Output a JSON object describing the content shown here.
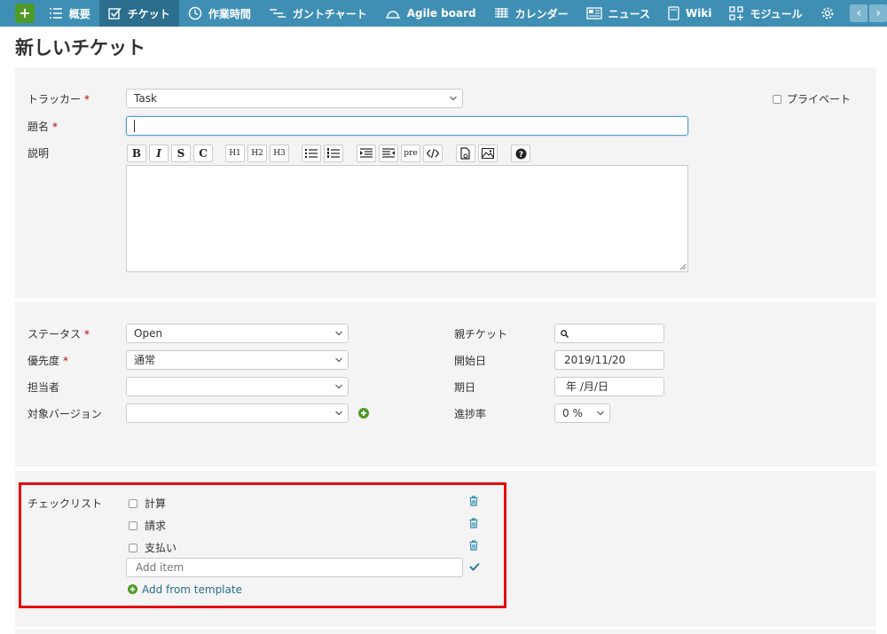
{
  "nav": {
    "items": [
      {
        "label": "概要",
        "icon": "list-icon"
      },
      {
        "label": "チケット",
        "icon": "checkbox-icon",
        "active": true
      },
      {
        "label": "作業時間",
        "icon": "clock-icon"
      },
      {
        "label": "ガントチャート",
        "icon": "gantt-icon"
      },
      {
        "label": "Agile board",
        "icon": "agile-icon"
      },
      {
        "label": "カレンダー",
        "icon": "calendar-icon"
      },
      {
        "label": "ニュース",
        "icon": "news-icon"
      },
      {
        "label": "Wiki",
        "icon": "wiki-icon"
      },
      {
        "label": "モジュール",
        "icon": "modules-icon"
      }
    ],
    "accent": "#3f8fb5"
  },
  "page": {
    "title": "新しいチケット"
  },
  "form": {
    "tracker": {
      "label": "トラッカー",
      "value": "Task"
    },
    "private": {
      "label": "プライベート"
    },
    "subject": {
      "label": "題名",
      "value": ""
    },
    "description": {
      "label": "説明"
    },
    "toolbar": [
      "B",
      "I",
      "S",
      "C",
      "H1",
      "H2",
      "H3",
      "pre"
    ]
  },
  "attributes": {
    "status": {
      "label": "ステータス",
      "value": "Open"
    },
    "priority": {
      "label": "優先度",
      "value": "通常"
    },
    "assignee": {
      "label": "担当者",
      "value": ""
    },
    "version": {
      "label": "対象バージョン",
      "value": ""
    },
    "parent": {
      "label": "親チケット",
      "value": ""
    },
    "start_date": {
      "label": "開始日",
      "value": "2019/11/20"
    },
    "due_date": {
      "label": "期日",
      "value": "年 /月/日"
    },
    "done_ratio": {
      "label": "進捗率",
      "value": "0 %"
    }
  },
  "checklist": {
    "label": "チェックリスト",
    "items": [
      "計算",
      "請求",
      "支払い"
    ],
    "add_placeholder": "Add item",
    "add_from_template": "Add from template"
  },
  "colors": {
    "required": "#bb0000",
    "highlight": "#e30d0d",
    "link": "#2b6e8e",
    "green": "#4e9a28"
  }
}
